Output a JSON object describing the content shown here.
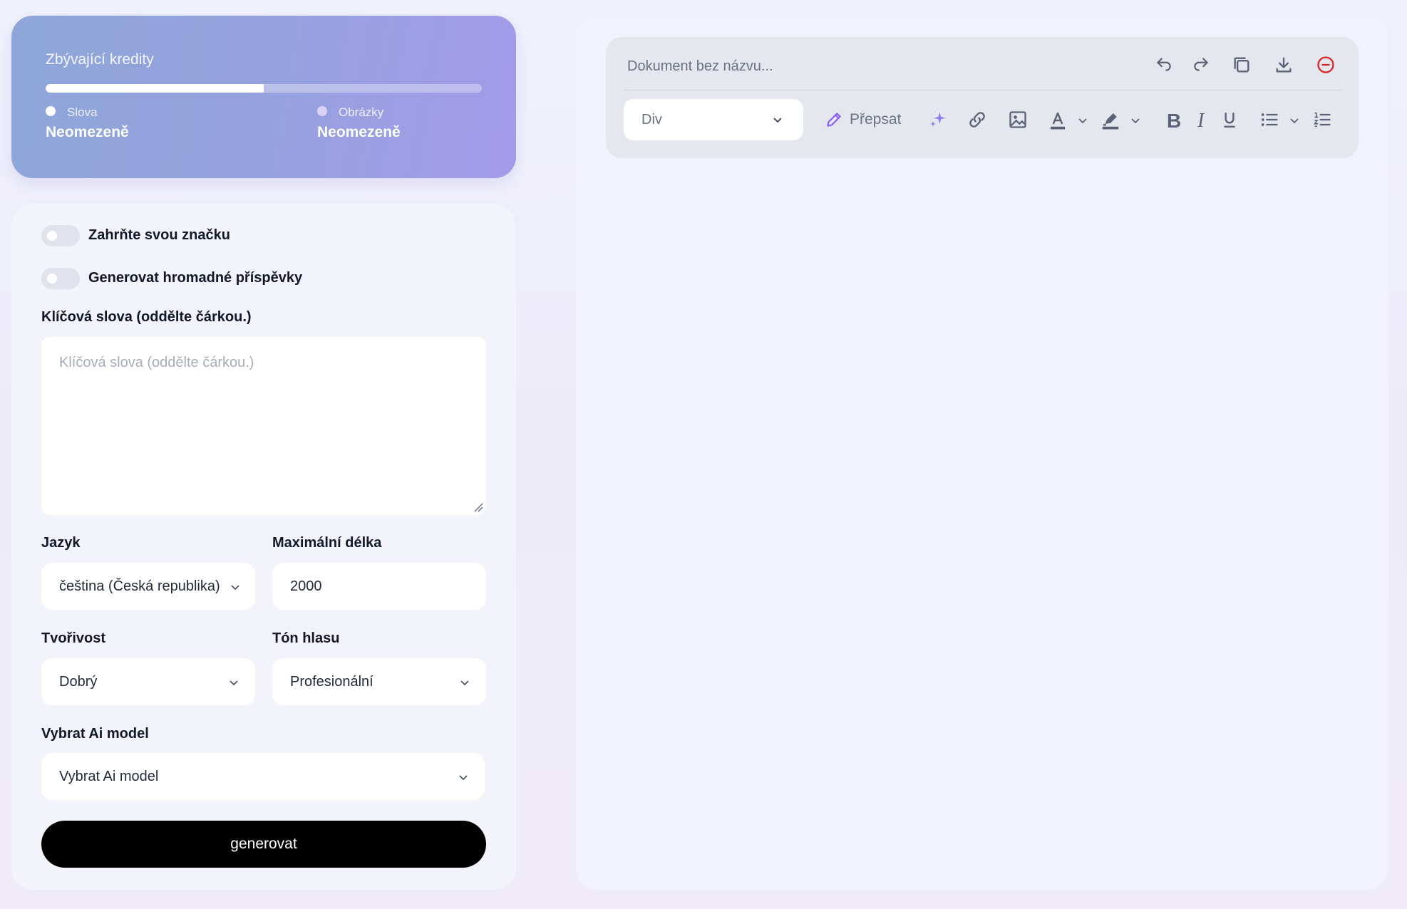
{
  "credits": {
    "title": "Zbývající kredity",
    "progress_fraction": 0.5,
    "words": {
      "label": "Slova",
      "value": "Neomezeně"
    },
    "images": {
      "label": "Obrázky",
      "value": "Neomezeně"
    }
  },
  "form": {
    "toggle_brand": "Zahrňte svou značku",
    "toggle_bulk": "Generovat hromadné příspěvky",
    "keywords_label": "Klíčová slova (oddělte čárkou.)",
    "keywords_placeholder": "Klíčová slova (oddělte čárkou.)",
    "language_label": "Jazyk",
    "language_value": "čeština (Česká republika)",
    "maxlen_label": "Maximální délka",
    "maxlen_value": "2000",
    "creativity_label": "Tvořivost",
    "creativity_value": "Dobrý",
    "tone_label": "Tón hlasu",
    "tone_value": "Profesionální",
    "model_label": "Vybrat Ai model",
    "model_value": "Vybrat Ai model",
    "generate_label": "generovat"
  },
  "editor": {
    "doc_title_placeholder": "Dokument bez názvu...",
    "block_type": "Div",
    "rewrite_label": "Přepsat",
    "colors": {
      "icon": "#5b6275",
      "accent": "#8b5cf6",
      "danger": "#dc2626"
    }
  }
}
